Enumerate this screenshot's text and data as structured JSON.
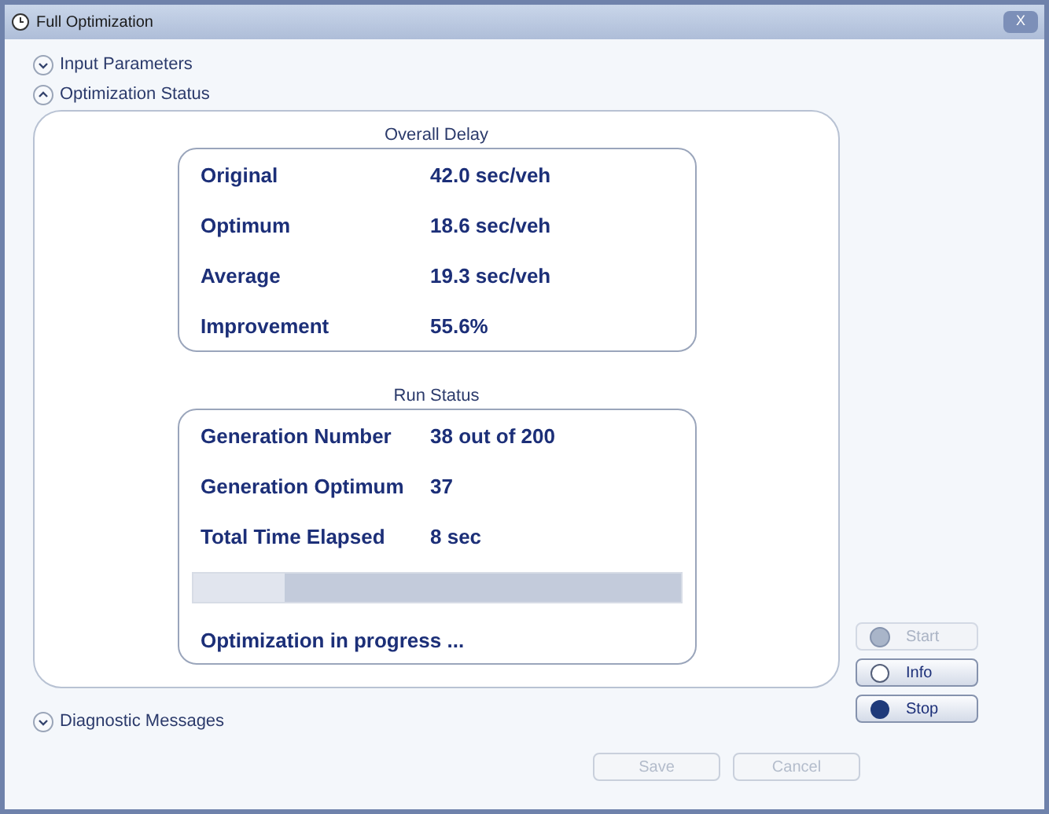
{
  "window": {
    "title": "Full Optimization",
    "close": "X"
  },
  "sections": [
    {
      "label": "Input Parameters",
      "expanded": false
    },
    {
      "label": "Optimization Status",
      "expanded": true
    }
  ],
  "overall_delay": {
    "title": "Overall Delay",
    "rows": [
      {
        "label": "Original",
        "value": "42.0 sec/veh"
      },
      {
        "label": "Optimum",
        "value": "18.6 sec/veh"
      },
      {
        "label": "Average",
        "value": "19.3 sec/veh"
      },
      {
        "label": "Improvement",
        "value": "55.6%"
      }
    ]
  },
  "run_status": {
    "title": "Run Status",
    "rows": [
      {
        "label": "Generation Number",
        "value": "38 out of 200"
      },
      {
        "label": "Generation Optimum",
        "value": "37"
      },
      {
        "label": "Total Time Elapsed",
        "value": "8 sec"
      }
    ],
    "progress": {
      "level": 0.19
    },
    "message": "Optimization in progress ..."
  },
  "side_buttons": [
    {
      "label": "Start",
      "disabled": true,
      "kind": "start"
    },
    {
      "label": "Info",
      "disabled": false,
      "kind": "info"
    },
    {
      "label": "Stop",
      "disabled": false,
      "kind": "stop"
    }
  ],
  "diagnostic": {
    "label": "Diagnostic Messages",
    "expanded": false
  },
  "footer_buttons": [
    {
      "label": "Save",
      "disabled": true
    },
    {
      "label": "Cancel",
      "disabled": true
    }
  ]
}
